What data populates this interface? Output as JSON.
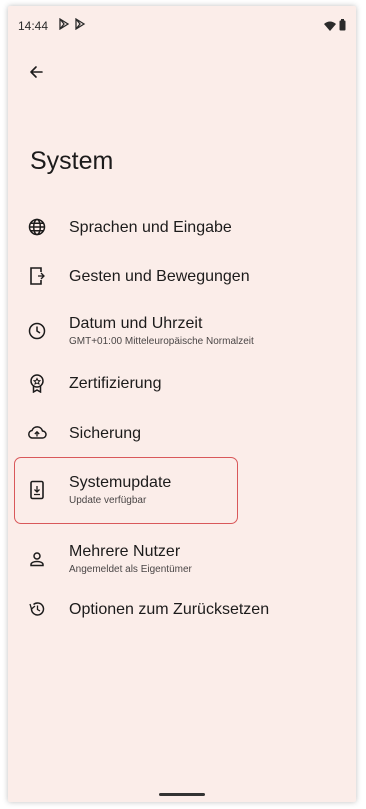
{
  "status_bar": {
    "time": "14:44",
    "notifications": [
      "play-store-icon",
      "play-store-icon"
    ],
    "right_icons": [
      "wifi-icon",
      "battery-icon"
    ]
  },
  "header": {
    "back_icon": "arrow-back-icon",
    "title": "System"
  },
  "settings_items": [
    {
      "icon": "globe-icon",
      "label": "Sprachen und Eingabe",
      "subtitle": ""
    },
    {
      "icon": "gesture-phone-icon",
      "label": "Gesten und Bewegungen",
      "subtitle": ""
    },
    {
      "icon": "clock-icon",
      "label": "Datum und Uhrzeit",
      "subtitle": "GMT+01:00 Mitteleuropäische Normalzeit"
    },
    {
      "icon": "certificate-icon",
      "label": "Zertifizierung",
      "subtitle": ""
    },
    {
      "icon": "cloud-upload-icon",
      "label": "Sicherung",
      "subtitle": ""
    },
    {
      "icon": "system-update-icon",
      "label": "Systemupdate",
      "subtitle": "Update verfügbar"
    },
    {
      "icon": "person-icon",
      "label": "Mehrere Nutzer",
      "subtitle": "Angemeldet als Eigentümer"
    },
    {
      "icon": "restore-icon",
      "label": "Optionen zum Zurücksetzen",
      "subtitle": ""
    }
  ],
  "colors": {
    "background": "#fbede9",
    "highlight": "#d9585a",
    "text": "#1c1b1b"
  }
}
